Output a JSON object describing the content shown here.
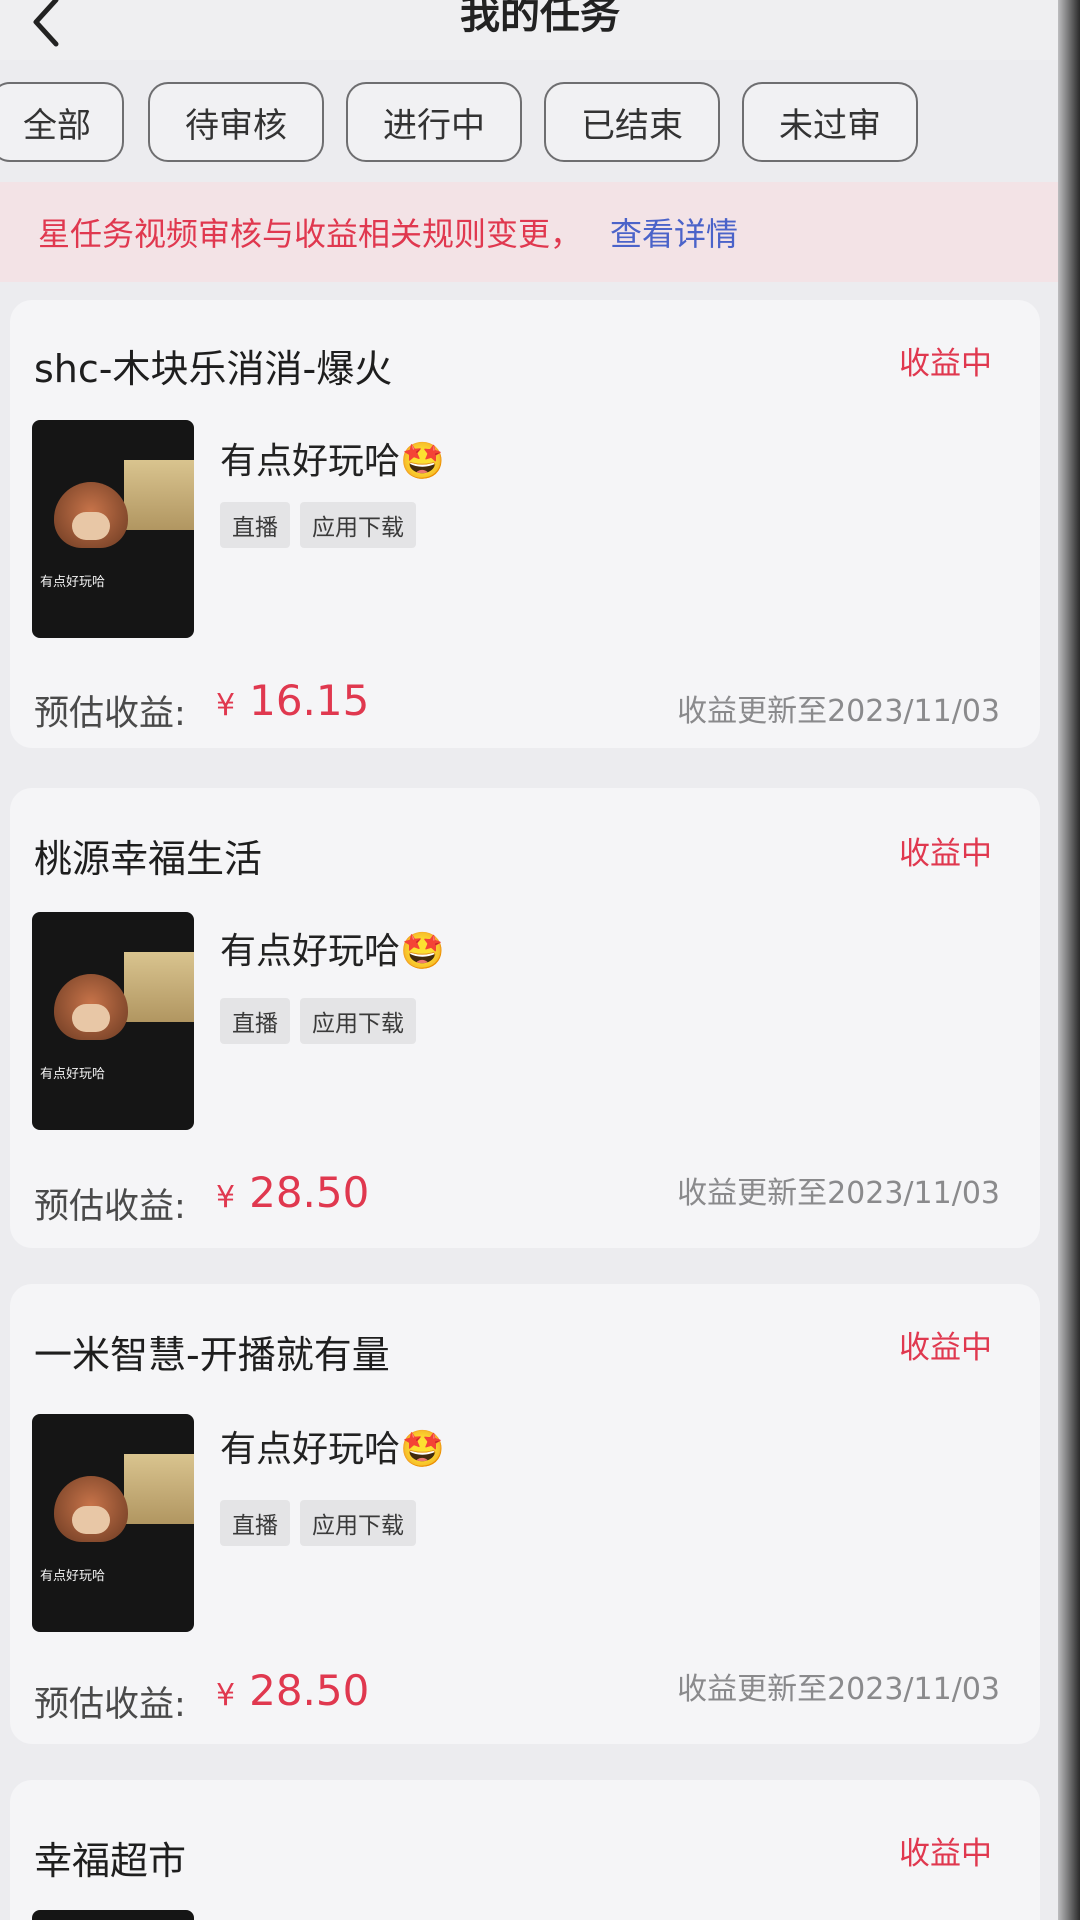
{
  "header": {
    "title": "我的任务",
    "back_icon": "chevron-left-icon"
  },
  "tabs": [
    {
      "label": "全部"
    },
    {
      "label": "待审核"
    },
    {
      "label": "进行中"
    },
    {
      "label": "已结束"
    },
    {
      "label": "未过审"
    }
  ],
  "notice": {
    "text": "星任务视频审核与收益相关规则变更，",
    "link": "查看详情"
  },
  "tasks": [
    {
      "title": "shc-木块乐消消-爆火",
      "status": "收益中",
      "video_title": "有点好玩哈🤩",
      "thumb_caption": "有点好玩哈",
      "tags": [
        "直播",
        "应用下载"
      ],
      "earn_label": "预估收益:",
      "currency": "¥",
      "earn_value": "16.15",
      "updated": "收益更新至2023/11/03"
    },
    {
      "title": "桃源幸福生活",
      "status": "收益中",
      "video_title": "有点好玩哈🤩",
      "thumb_caption": "有点好玩哈",
      "tags": [
        "直播",
        "应用下载"
      ],
      "earn_label": "预估收益:",
      "currency": "¥",
      "earn_value": "28.50",
      "updated": "收益更新至2023/11/03"
    },
    {
      "title": "一米智慧-开播就有量",
      "status": "收益中",
      "video_title": "有点好玩哈🤩",
      "thumb_caption": "有点好玩哈",
      "tags": [
        "直播",
        "应用下载"
      ],
      "earn_label": "预估收益:",
      "currency": "¥",
      "earn_value": "28.50",
      "updated": "收益更新至2023/11/03"
    },
    {
      "title": "幸福超市",
      "status": "收益中"
    }
  ],
  "colors": {
    "accent_red": "#e0384f",
    "link_blue": "#4b63c9",
    "notice_bg": "#f3e3e6"
  }
}
